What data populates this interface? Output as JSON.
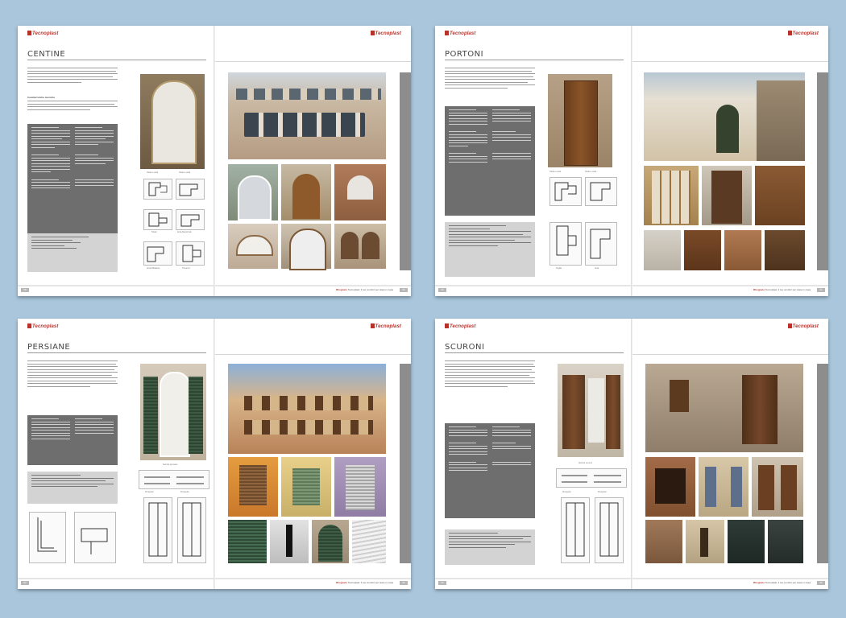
{
  "brand": "Tecnoplast",
  "footer": {
    "brand": "Rhogneto",
    "tagline": "Tecnoplast: il tuo comfort per stare in casa"
  },
  "spreads": [
    {
      "title": "CENTINE",
      "page_left": "58",
      "page_right": "59",
      "heading_specs": "Caratteristiche tecniche",
      "captions": [
        "Telaio e anta",
        "Telaio e anta",
        "Telaio",
        "Anta-Davanzale",
        "Anta-Ribattuta",
        "Traverso"
      ]
    },
    {
      "title": "PORTONI",
      "page_left": "60",
      "page_right": "61",
      "heading_specs": "Caratteristiche tecniche",
      "captions": [
        "Telaio e anta",
        "Telaio e anta",
        "Soglia",
        "Anta"
      ]
    },
    {
      "title": "PERSIANE",
      "page_left": "62",
      "page_right": "63",
      "heading_specs": "Dettagli Tecnici",
      "captions": [
        "Sezioni persiane",
        "Prospetto",
        "Prospetto",
        "Profilo telaio",
        "Profilo telaio"
      ]
    },
    {
      "title": "SCURONI",
      "page_left": "64",
      "page_right": "65",
      "heading_specs": "Dettagli Tecnici",
      "captions": [
        "Sezioni scuroni",
        "Prospetto",
        "Prospetto"
      ]
    }
  ],
  "colors": {
    "background": "#a9c6dc",
    "brand_red": "#b8322b",
    "panel_dark": "#6e6e6e",
    "panel_light": "#d3d3d3"
  }
}
